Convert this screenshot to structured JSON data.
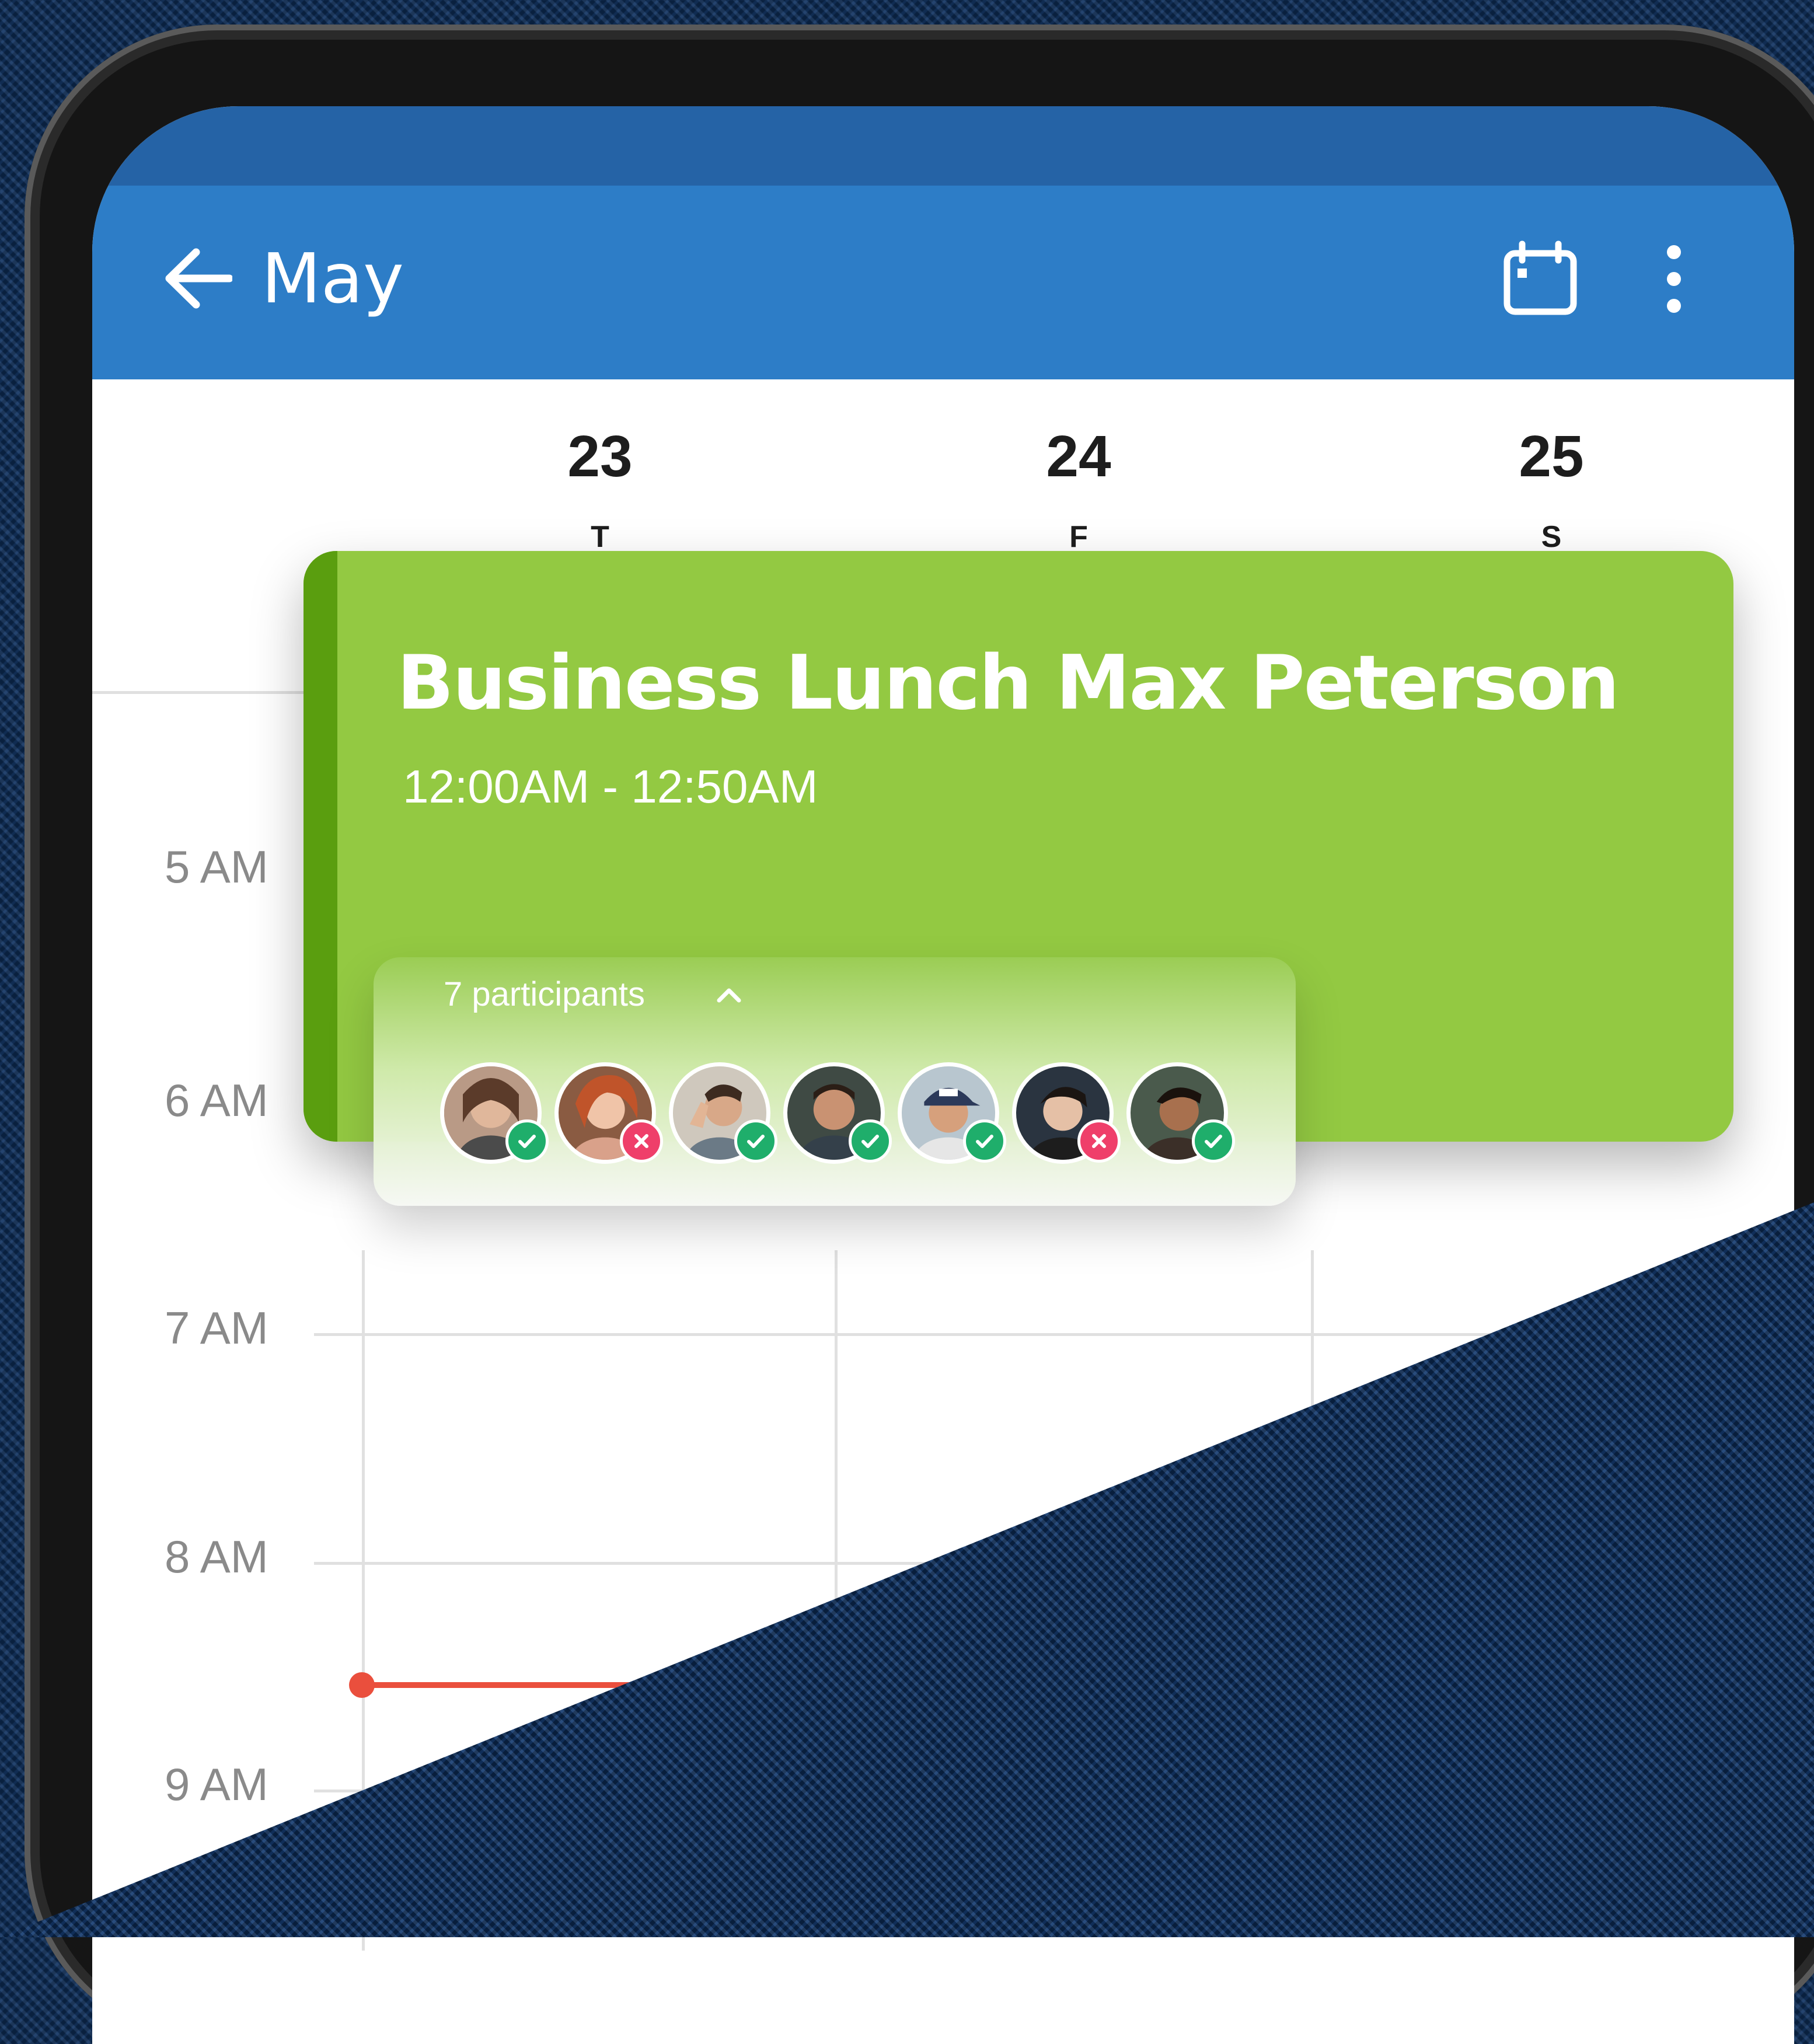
{
  "appbar": {
    "title": "May",
    "back_icon": "arrow-left-icon",
    "calendar_icon": "calendar-icon",
    "more_icon": "more-vertical-icon",
    "color": "#2d7dc7"
  },
  "days": [
    {
      "num": "23",
      "letter": "T"
    },
    {
      "num": "24",
      "letter": "F"
    },
    {
      "num": "25",
      "letter": "S"
    }
  ],
  "hours": [
    "5 AM",
    "6 AM",
    "7 AM",
    "8 AM",
    "9 AM"
  ],
  "event": {
    "title": "Business Lunch Max Peterson",
    "time": "12:00AM - 12:50AM",
    "color": "#93c942",
    "accent_color": "#5a9e0f"
  },
  "participants": {
    "label": "7 participants",
    "toggle_icon": "chevron-up-icon",
    "people": [
      {
        "status": "accepted"
      },
      {
        "status": "declined"
      },
      {
        "status": "accepted"
      },
      {
        "status": "accepted"
      },
      {
        "status": "accepted"
      },
      {
        "status": "declined"
      },
      {
        "status": "accepted"
      }
    ]
  },
  "colors": {
    "accepted": "#1fae6b",
    "declined": "#ef3f6a",
    "now_indicator": "#ea4f3d"
  }
}
